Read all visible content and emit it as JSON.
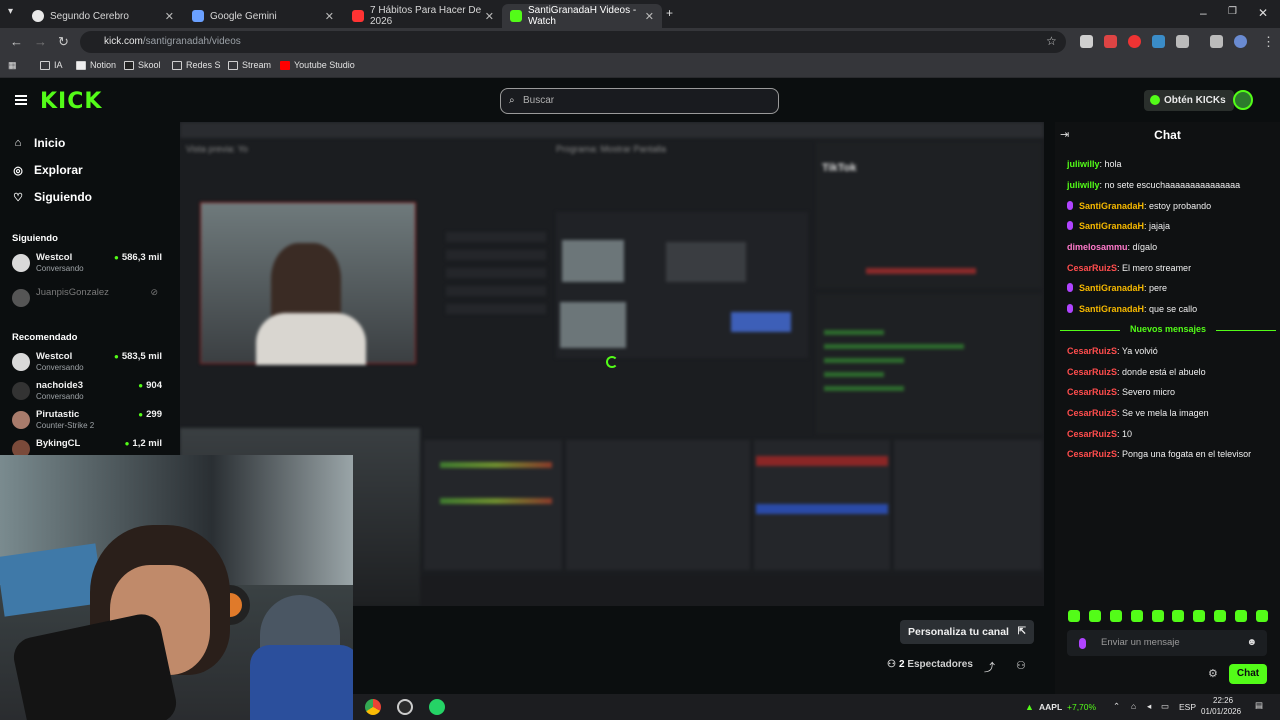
{
  "browser": {
    "tabs": [
      {
        "title": "Segundo Cerebro",
        "color": "#e8e8e8"
      },
      {
        "title": "Google Gemini",
        "color": "#6aa0ff"
      },
      {
        "title": "7 Hábitos Para Hacer De 2026",
        "color": "#ff3333"
      },
      {
        "title": "SantiGranadaH Videos - Watch",
        "color": "#53fc18"
      }
    ],
    "url_host": "kick.com",
    "url_path": "/santigranadah/videos",
    "bookmarks": [
      "IA",
      "Notion",
      "Skool",
      "Redes S",
      "Stream",
      "Youtube Studio"
    ]
  },
  "header": {
    "logo": "KICK",
    "search_placeholder": "Buscar",
    "kicks_button": "Obtén KICKs"
  },
  "sidebar": {
    "nav": [
      {
        "label": "Inicio",
        "icon": "home-icon"
      },
      {
        "label": "Explorar",
        "icon": "compass-icon"
      },
      {
        "label": "Siguiendo",
        "icon": "heart-icon"
      }
    ],
    "following_title": "Siguiendo",
    "following": [
      {
        "name": "Westcol",
        "sub": "Conversando",
        "count": "586,3 mil"
      },
      {
        "name": "JuanpisGonzalez",
        "sub": "",
        "count": ""
      }
    ],
    "recommended_title": "Recomendado",
    "recommended": [
      {
        "name": "Westcol",
        "sub": "Conversando",
        "count": "583,5 mil"
      },
      {
        "name": "nachoide3",
        "sub": "Conversando",
        "count": "904"
      },
      {
        "name": "Pirutastic",
        "sub": "Counter-Strike 2",
        "count": "299"
      },
      {
        "name": "BykingCL",
        "sub": "",
        "count": "1,2 mil"
      }
    ]
  },
  "video": {
    "obs_preview_label": "Vista previa: Yo",
    "obs_program_label": "Programa: Mostrar Pantalla",
    "tiktok_label": "TikTok"
  },
  "channel": {
    "customize_button": "Personaliza tu canal",
    "viewers_count": "2",
    "viewers_label": "Espectadores"
  },
  "chat": {
    "title": "Chat",
    "messages": [
      {
        "user": "juliwilly",
        "text": "hola",
        "color": "#53fc18",
        "mic": false
      },
      {
        "user": "juliwilly",
        "text": "no sete escuchaaaaaaaaaaaaaaa",
        "color": "#53fc18",
        "mic": false
      },
      {
        "user": "SantiGranadaH",
        "text": "estoy probando",
        "color": "#f5b800",
        "mic": true
      },
      {
        "user": "SantiGranadaH",
        "text": "jajaja",
        "color": "#f5b800",
        "mic": true
      },
      {
        "user": "dimelosammu",
        "text": "dígalo",
        "color": "#ff7acb",
        "mic": false
      },
      {
        "user": "CesarRuizS",
        "text": "El mero streamer",
        "color": "#ff4d4d",
        "mic": false
      },
      {
        "user": "SantiGranadaH",
        "text": "pere",
        "color": "#f5b800",
        "mic": true
      },
      {
        "user": "SantiGranadaH",
        "text": "que se callo",
        "color": "#f5b800",
        "mic": true
      }
    ],
    "new_messages_label": "Nuevos mensajes",
    "new_messages": [
      {
        "user": "CesarRuizS",
        "text": "Ya volvió",
        "color": "#ff4d4d"
      },
      {
        "user": "CesarRuizS",
        "text": "donde está el abuelo",
        "color": "#ff4d4d"
      },
      {
        "user": "CesarRuizS",
        "text": "Severo micro",
        "color": "#ff4d4d"
      },
      {
        "user": "CesarRuizS",
        "text": "Se ve mela la imagen",
        "color": "#ff4d4d"
      },
      {
        "user": "CesarRuizS",
        "text": "10",
        "color": "#ff4d4d"
      },
      {
        "user": "CesarRuizS",
        "text": "Ponga una fogata en el televisor",
        "color": "#ff4d4d"
      }
    ],
    "input_placeholder": "Enviar un mensaje",
    "send_button": "Chat"
  },
  "taskbar": {
    "ticker": "AAPL",
    "ticker_change": "+7,70%",
    "lang": "ESP",
    "time": "22:26",
    "date": "01/01/2026"
  },
  "colors": {
    "accent": "#53fc18",
    "background": "#0b0e0f"
  }
}
